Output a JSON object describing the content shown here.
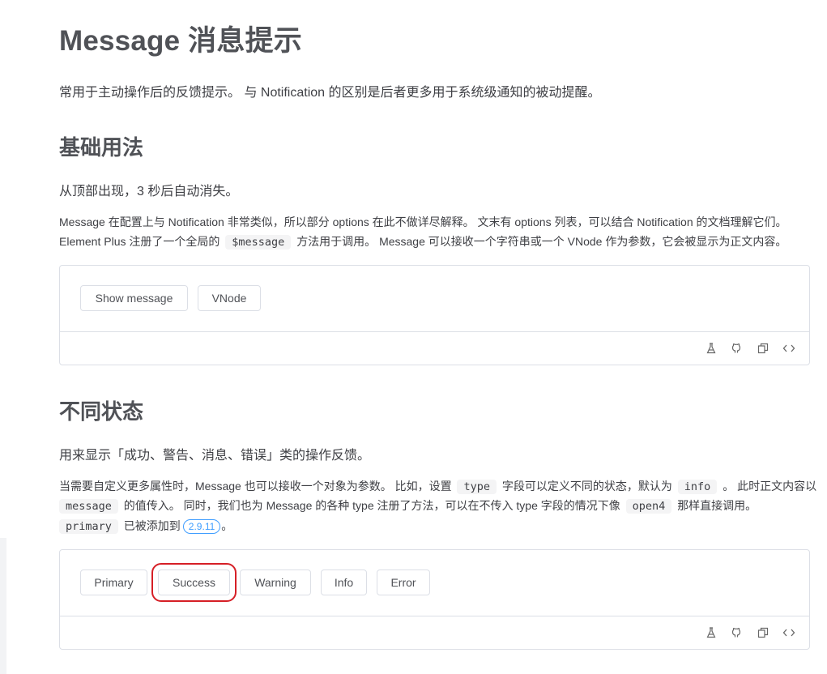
{
  "page": {
    "title": "Message 消息提示",
    "intro": "常用于主动操作后的反馈提示。 与 Notification 的区别是后者更多用于系统级通知的被动提醒。"
  },
  "basic": {
    "heading": "基础用法",
    "lead": "从顶部出现，3 秒后自动消失。",
    "desc1": "Message 在配置上与 Notification 非常类似，所以部分 options 在此不做详尽解释。 文末有 options 列表，可以结合 Notification 的文档理解它们。",
    "desc2_before": "Element Plus 注册了一个全局的",
    "desc2_code": "$message",
    "desc2_after": "方法用于调用。 Message 可以接收一个字符串或一个 VNode 作为参数，它会被显示为正文内容。",
    "buttons": [
      "Show message",
      "VNode"
    ]
  },
  "types": {
    "heading": "不同状态",
    "lead": "用来显示「成功、警告、消息、错误」类的操作反馈。",
    "line1_a": "当需要自定义更多属性时，Message 也可以接收一个对象为参数。 比如，设置",
    "line1_code1": "type",
    "line1_b": "字段可以定义不同的状态，默认为",
    "line1_code2": "info",
    "line1_c": "。 此时正文内容以",
    "line2_code1": "message",
    "line2_a": "的值传入。 同时，我们也为 Message 的各种 type 注册了方法，可以在不传入 type 字段的情况下像",
    "line2_code2": "open4",
    "line2_b": "那样直接调用。",
    "line3_code": "primary",
    "line3_a": "已被添加到",
    "line3_version": "2.9.11",
    "line3_b": "。",
    "buttons": [
      "Primary",
      "Success",
      "Warning",
      "Info",
      "Error"
    ]
  },
  "toolbar_icons": [
    "playground-icon",
    "github-icon",
    "copy-icon",
    "code-icon"
  ],
  "colors": {
    "highlight": "#d61f26",
    "link": "#409eff",
    "border": "#dcdfe6"
  }
}
